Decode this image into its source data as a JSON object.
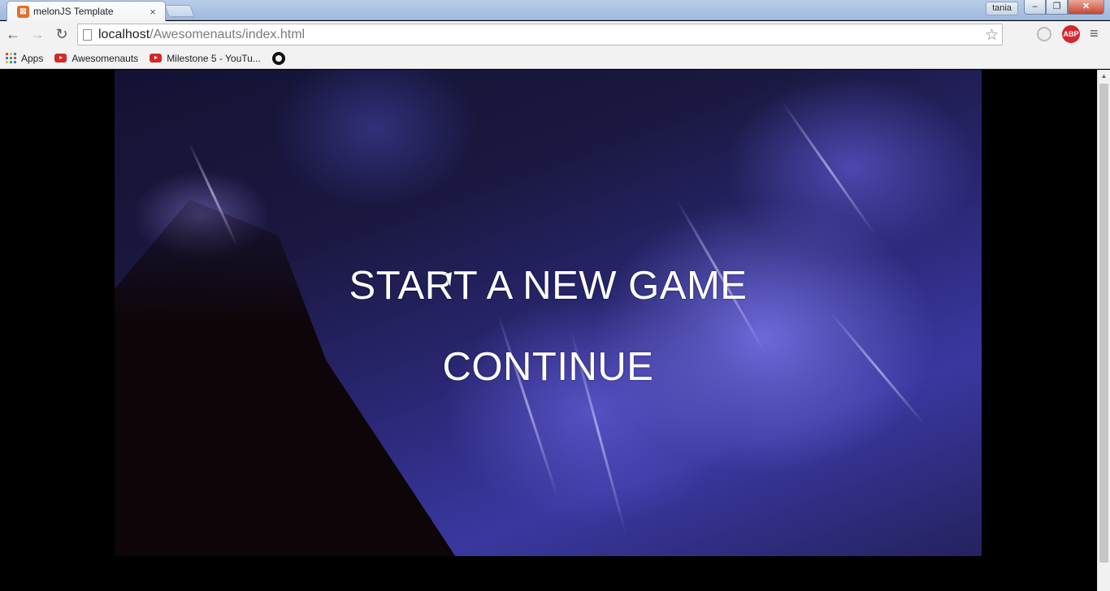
{
  "window": {
    "tab_title": "melonJS Template",
    "tab_favicon": "xampp-icon",
    "tab_close": "×",
    "profile_name": "tania",
    "controls": {
      "minimize": "–",
      "maximize": "❐",
      "close": "✕"
    }
  },
  "toolbar": {
    "back_icon": "←",
    "forward_icon": "→",
    "reload_icon": "↻",
    "url_host": "localhost",
    "url_path": "/Awesomenauts/index.html",
    "star_icon": "☆",
    "abp_label": "ABP",
    "menu_icon": "≡"
  },
  "bookmarks": {
    "items": [
      {
        "label": "Apps",
        "icon": "apps-grid-icon"
      },
      {
        "label": "Awesomenauts",
        "icon": "youtube-icon"
      },
      {
        "label": "Milestone 5 - YouTu...",
        "icon": "youtube-icon"
      },
      {
        "label": "",
        "icon": "github-icon"
      }
    ]
  },
  "game": {
    "menu": {
      "start": "START A NEW GAME",
      "continue": "CONTINUE"
    }
  },
  "scrollbar": {
    "up_arrow": "▲",
    "down_arrow": "▼"
  }
}
